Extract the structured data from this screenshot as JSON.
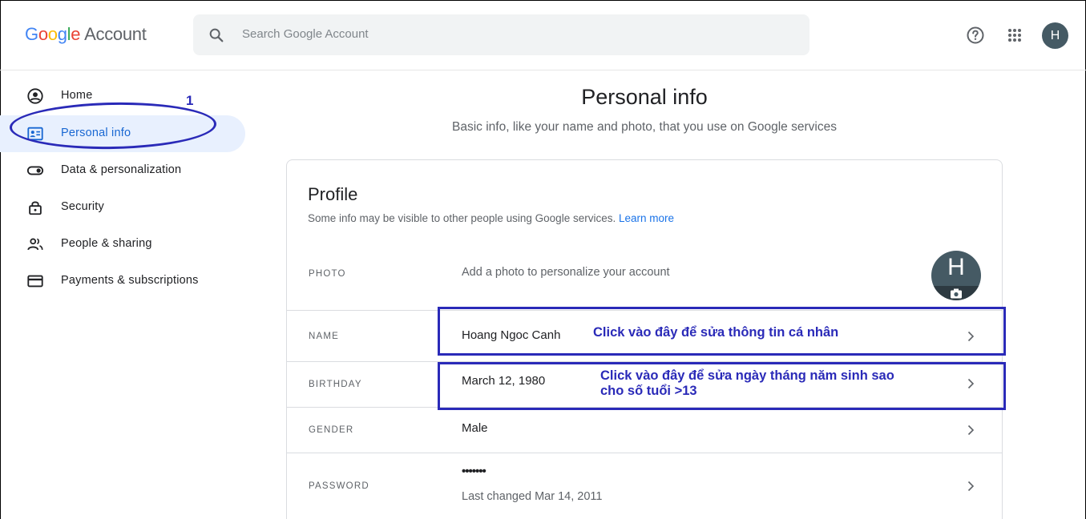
{
  "header": {
    "logo_google": [
      "G",
      "o",
      "o",
      "g",
      "l",
      "e"
    ],
    "logo_account": "Account",
    "search_placeholder": "Search Google Account",
    "avatar_letter": "H"
  },
  "sidebar": {
    "items": [
      {
        "label": "Home",
        "icon": "home-account-icon"
      },
      {
        "label": "Personal info",
        "icon": "id-card-icon"
      },
      {
        "label": "Data & personalization",
        "icon": "toggle-icon"
      },
      {
        "label": "Security",
        "icon": "lock-icon"
      },
      {
        "label": "People & sharing",
        "icon": "people-icon"
      },
      {
        "label": "Payments & subscriptions",
        "icon": "credit-card-icon"
      }
    ],
    "active_index": 1,
    "annotation_number": "1"
  },
  "main": {
    "title": "Personal info",
    "subtitle": "Basic info, like your name and photo, that you use on Google services"
  },
  "profile": {
    "title": "Profile",
    "description": "Some info may be visible to other people using Google services.",
    "learn_more": "Learn more",
    "rows": [
      {
        "label": "PHOTO",
        "value": "Add a photo to personalize your account",
        "avatar_letter": "H"
      },
      {
        "label": "NAME",
        "value": "Hoang Ngoc Canh"
      },
      {
        "label": "BIRTHDAY",
        "value": "March 12, 1980"
      },
      {
        "label": "GENDER",
        "value": "Male"
      },
      {
        "label": "PASSWORD",
        "value": "•••••••",
        "sub": "Last changed Mar 14, 2011"
      }
    ]
  },
  "annotations": {
    "name_note": "Click vào đây để sửa thông tin cá nhân",
    "birthday_note_line1": "Click vào đây để sửa ngày tháng năm sinh sao",
    "birthday_note_line2": "cho số tuổi >13"
  },
  "colors": {
    "accent": "#1a73e8",
    "active_bg": "#e8f0fe",
    "annotation": "#2a2ab8",
    "avatar": "#455a64",
    "logo": [
      "#4285f4",
      "#ea4335",
      "#fbbc05",
      "#4285f4",
      "#34a853",
      "#ea4335"
    ]
  }
}
